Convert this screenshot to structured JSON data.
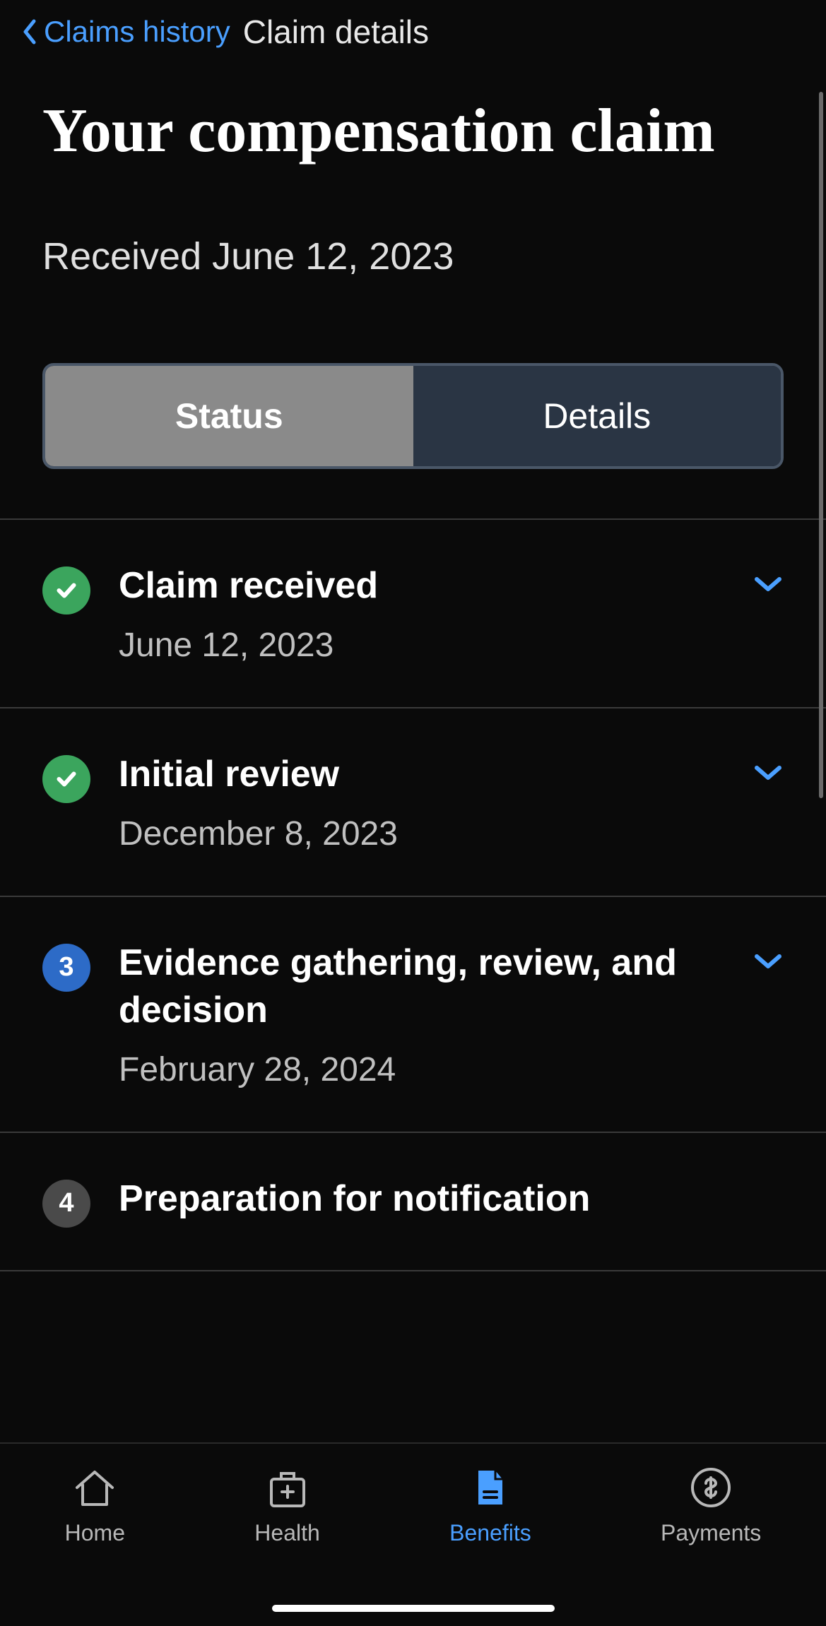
{
  "header": {
    "back_label": "Claims history",
    "title": "Claim details"
  },
  "page": {
    "title": "Your compensation claim",
    "received_prefix": "Received ",
    "received_date": "June 12, 2023"
  },
  "tabs": {
    "status": "Status",
    "details": "Details"
  },
  "steps": [
    {
      "state": "done",
      "title": "Claim received",
      "date": "June 12, 2023",
      "expandable": true
    },
    {
      "state": "done",
      "title": "Initial review",
      "date": "December 8, 2023",
      "expandable": true
    },
    {
      "state": "current",
      "number": "3",
      "title": "Evidence gathering, review, and decision",
      "date": "February 28, 2024",
      "expandable": true
    },
    {
      "state": "pending",
      "number": "4",
      "title": "Preparation for notification",
      "date": "",
      "expandable": false
    }
  ],
  "nav": {
    "home": "Home",
    "health": "Health",
    "benefits": "Benefits",
    "payments": "Payments"
  }
}
